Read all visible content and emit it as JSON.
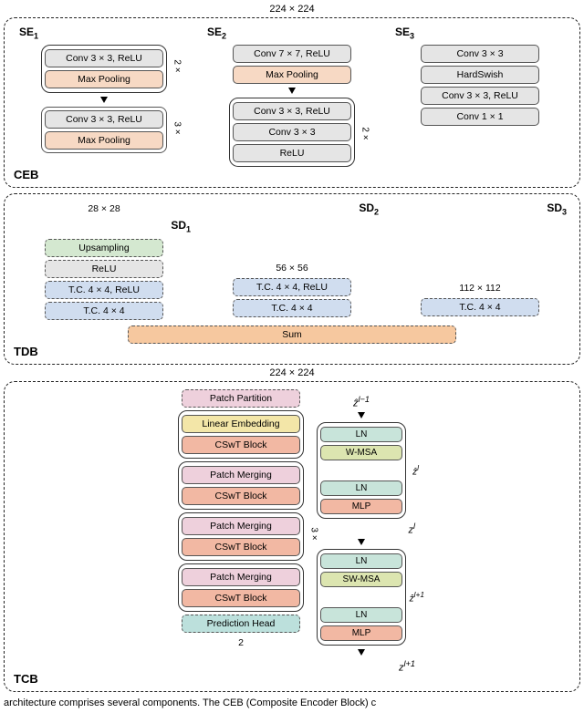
{
  "input_dim": "224 × 224",
  "ceb": {
    "label": "CEB",
    "se1": {
      "label": "SE",
      "sub": "1",
      "group1_mult": "2 ×",
      "conv1": "Conv 3 × 3, ReLU",
      "pool1": "Max Pooling",
      "group2_mult": "3 ×",
      "conv2": "Conv 3 × 3, ReLU",
      "pool2": "Max Pooling",
      "out_dim": "28 × 28"
    },
    "se2": {
      "label": "SE",
      "sub": "2",
      "conv1": "Conv 7 × 7, ReLU",
      "pool1": "Max Pooling",
      "group_mult": "2 ×",
      "g_conv1": "Conv 3 × 3, ReLU",
      "g_conv2": "Conv 3 × 3",
      "g_relu": "ReLU"
    },
    "se3": {
      "label": "SE",
      "sub": "3",
      "b1": "Conv 3 × 3",
      "b2": "HardSwish",
      "b3": "Conv 3 × 3, ReLU",
      "b4": "Conv 1 × 1"
    }
  },
  "tdb": {
    "label": "TDB",
    "sd1": {
      "label": "SD",
      "sub": "1",
      "b1": "Upsampling",
      "b2": "ReLU",
      "b3": "T.C. 4 × 4, ReLU",
      "b4": "T.C. 4 × 4"
    },
    "sd2": {
      "label": "SD",
      "sub": "2",
      "dim": "56 × 56",
      "b1": "T.C. 4 × 4, ReLU",
      "b2": "T.C. 4 × 4"
    },
    "sd3": {
      "label": "SD",
      "sub": "3",
      "dim": "112 × 112",
      "b1": "T.C. 4 × 4"
    },
    "sum": "Sum",
    "out_dim": "224 × 224"
  },
  "tcb": {
    "label": "TCB",
    "patch_partition": "Patch Partition",
    "stage1": {
      "b1": "Linear Embedding",
      "b2": "CSwT Block"
    },
    "stage2": {
      "b1": "Patch Merging",
      "b2": "CSwT Block"
    },
    "stage3": {
      "b1": "Patch Merging",
      "b2": "CSwT Block",
      "mult": "3 ×"
    },
    "stage4": {
      "b1": "Patch Merging",
      "b2": "CSwT Block"
    },
    "head": "Prediction Head",
    "out": "2",
    "detail": {
      "z_in": "ẑ",
      "z_in_sup": "l−1",
      "g1": {
        "ln1": "LN",
        "msa": "W-MSA",
        "ln2": "LN",
        "mlp": "MLP"
      },
      "z_mid_hat": "ẑ",
      "z_mid_hat_sup": "l",
      "z_mid": "z",
      "z_mid_sup": "l",
      "g2": {
        "ln1": "LN",
        "msa": "SW-MSA",
        "ln2": "LN",
        "mlp": "MLP"
      },
      "z_out_hat": "ẑ",
      "z_out_hat_sup": "l+1",
      "z_out": "z",
      "z_out_sup": "l+1"
    }
  },
  "caption": "architecture comprises several components. The CEB (Composite Encoder Block) c"
}
